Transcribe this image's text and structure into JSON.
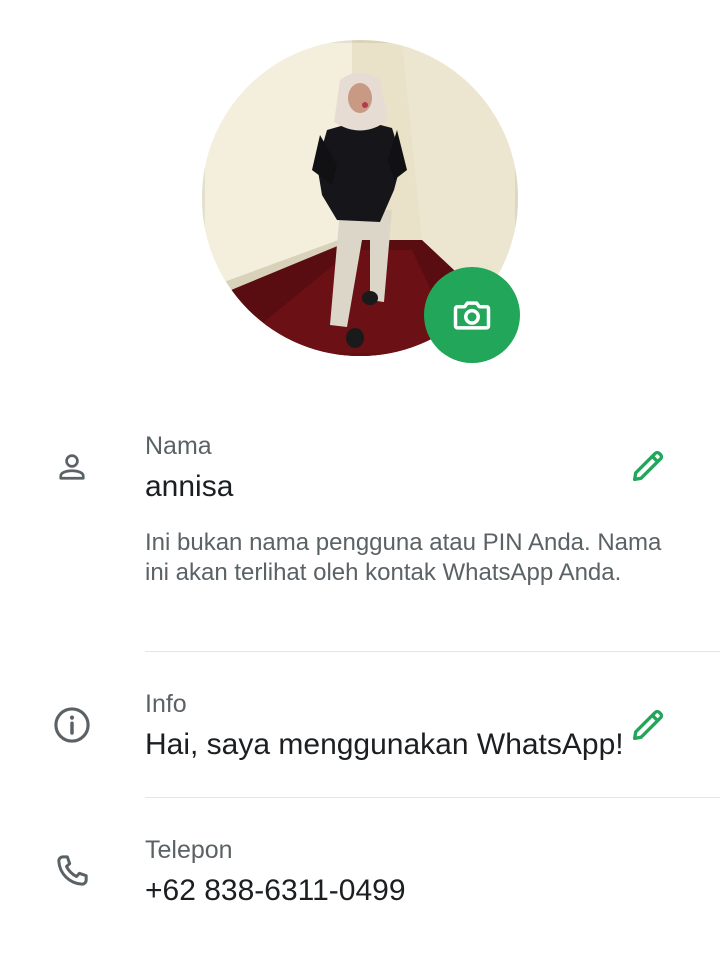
{
  "profile": {
    "photo_icon": "camera-icon"
  },
  "name_row": {
    "icon": "person-icon",
    "label": "Nama",
    "value": "annisa",
    "hint": "Ini bukan nama pengguna atau PIN Anda. Nama ini akan terlihat oleh kontak WhatsApp Anda.",
    "edit_icon": "pencil-icon"
  },
  "about_row": {
    "icon": "info-icon",
    "label": "Info",
    "value": "Hai, saya menggunakan WhatsApp!",
    "edit_icon": "pencil-icon"
  },
  "phone_row": {
    "icon": "phone-icon",
    "label": "Telepon",
    "value": "+62 838-6311-0499"
  },
  "colors": {
    "accent": "#21a65a",
    "text_primary": "#1b1f21",
    "text_secondary": "#5b6266",
    "divider": "#e3e5e6"
  }
}
